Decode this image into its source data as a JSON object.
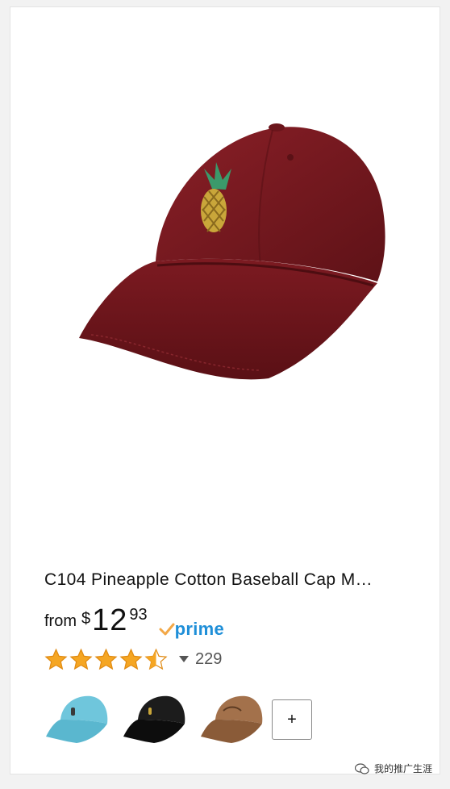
{
  "product": {
    "title": "C104 Pineapple Cotton Baseball Cap M…",
    "price": {
      "prefix": "from",
      "currency_symbol": "$",
      "whole": "12",
      "fraction": "93"
    },
    "prime_label": "prime",
    "rating": {
      "value_out_of_5": 4.5,
      "review_count": "229"
    },
    "more_colors_label": "+",
    "swatches": [
      {
        "name": "light-blue",
        "color": "#6fc6dc"
      },
      {
        "name": "black",
        "color": "#161616"
      },
      {
        "name": "brown",
        "color": "#9b6a45"
      }
    ],
    "main_image_color": "#7a1a20"
  },
  "colors": {
    "prime_blue": "#1f8fd8",
    "prime_check": "#f3a847",
    "star_fill": "#f5a623",
    "star_outline": "#e08a12"
  },
  "watermark": {
    "text": "我的推广生涯"
  }
}
